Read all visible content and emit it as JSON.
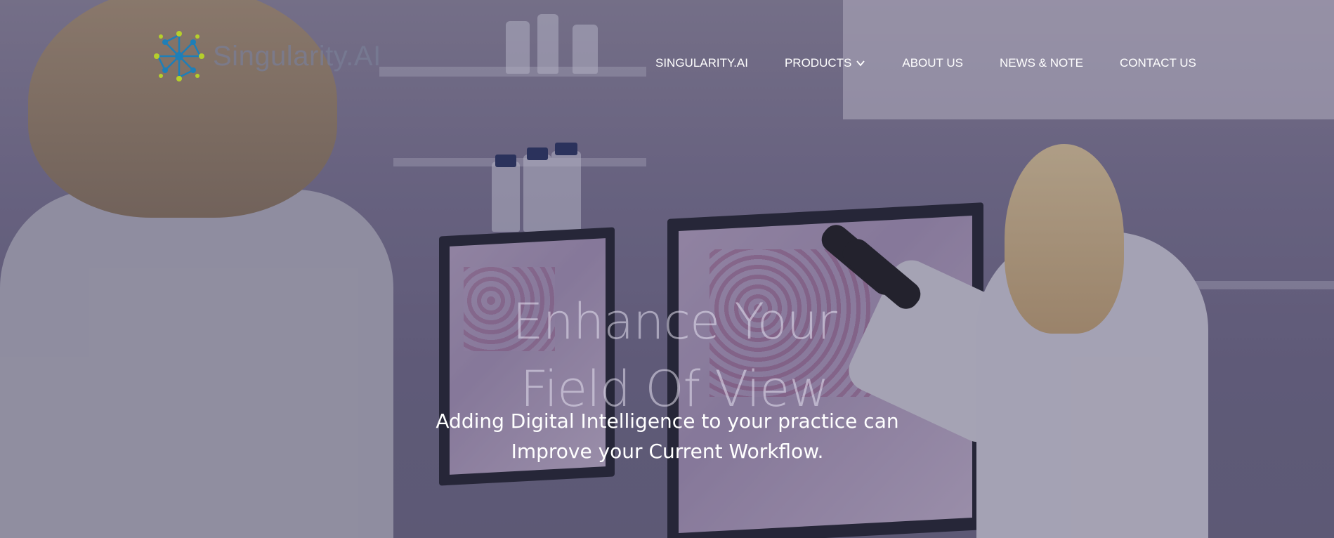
{
  "brand": {
    "name": "Singularity.AI",
    "accent_blue": "#1e7fb8",
    "accent_green": "#b5cf2b"
  },
  "nav": {
    "items": [
      {
        "label": "SINGULARITY.AI",
        "has_dropdown": false
      },
      {
        "label": "PRODUCTS",
        "has_dropdown": true,
        "icon": "chevron-down-icon"
      },
      {
        "label": "ABOUT US",
        "has_dropdown": false
      },
      {
        "label": "NEWS & NOTE",
        "has_dropdown": false
      },
      {
        "label": "CONTACT US",
        "has_dropdown": false
      }
    ]
  },
  "hero": {
    "headline_line1": "Enhance Your",
    "headline_line2": "Field Of View",
    "subline_line1": "Adding Digital Intelligence to your practice can",
    "subline_line2": "Improve your Current Workflow.",
    "background": "laboratory-scene-image"
  }
}
